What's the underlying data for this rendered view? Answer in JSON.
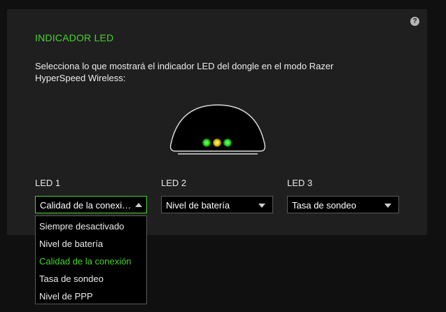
{
  "section": {
    "title": "INDICADOR LED",
    "description": "Selecciona lo que mostrará el indicador LED del dongle en el modo Razer HyperSpeed Wireless:",
    "help_icon": "?"
  },
  "colors": {
    "accent": "#44d62c",
    "led_green": "#2ee82e",
    "led_yellow": "#f2d21a"
  },
  "leds": [
    {
      "label": "LED 1",
      "value": "Calidad de la conexi…",
      "open": true
    },
    {
      "label": "LED 2",
      "value": "Nivel de batería",
      "open": false
    },
    {
      "label": "LED 3",
      "value": "Tasa de sondeo",
      "open": false
    }
  ],
  "dropdown": {
    "options": [
      "Siempre desactivado",
      "Nivel de batería",
      "Calidad de la conexión",
      "Tasa de sondeo",
      "Nivel de PPP"
    ],
    "selected": "Calidad de la conexión"
  }
}
